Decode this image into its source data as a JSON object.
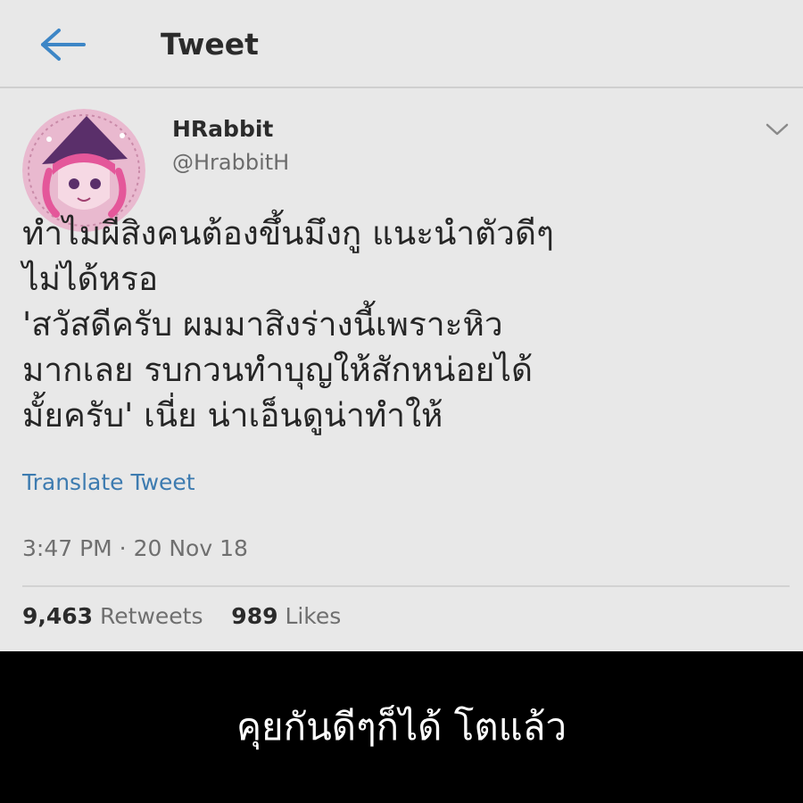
{
  "header": {
    "title": "Tweet",
    "back_icon": "arrow-left-icon",
    "accent": "#3d86c6"
  },
  "tweet": {
    "display_name": "HRabbit",
    "handle": "@HrabbitH",
    "avatar": "avatar-illustration",
    "text": "ทำไมผีสิงคนต้องขึ้นมึงกู แนะนำตัวดีๆ\nไม่ได้หรอ\n'สวัสดีครับ ผมมาสิงร่างนี้เพราะหิว\nมากเลย รบกวนทำบุญให้สักหน่อยได้\nมั้ยครับ' เนี่ย น่าเอ็นดูน่าทำให้",
    "translate_label": "Translate Tweet",
    "timestamp": "3:47 PM · 20 Nov 18",
    "retweets_count": "9,463",
    "retweets_label": "Retweets",
    "likes_count": "989",
    "likes_label": "Likes",
    "link_color": "#3d7bb0"
  },
  "caption": {
    "text": "คุยกันดีๆก็ได้ โตแล้ว"
  }
}
